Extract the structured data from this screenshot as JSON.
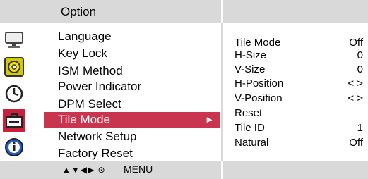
{
  "header": {
    "title": "Option"
  },
  "menu": {
    "items": [
      {
        "label": "Language"
      },
      {
        "label": "Key Lock"
      },
      {
        "label": "ISM Method"
      },
      {
        "label": "Power Indicator"
      },
      {
        "label": "DPM Select"
      },
      {
        "label": "Tile Mode",
        "selected": true
      },
      {
        "label": "Network Setup"
      },
      {
        "label": "Factory Reset"
      }
    ],
    "selected_arrow": "►"
  },
  "submenu": {
    "rows": [
      {
        "label": "Tile Mode",
        "value": "Off"
      },
      {
        "label": "H-Size",
        "value": "0"
      },
      {
        "label": "V-Size",
        "value": "0"
      },
      {
        "label": "H-Position",
        "value": "< >"
      },
      {
        "label": "V-Position",
        "value": "< >"
      },
      {
        "label": "Reset",
        "value": ""
      },
      {
        "label": "Tile ID",
        "value": "1"
      },
      {
        "label": "Natural",
        "value": "Off"
      }
    ]
  },
  "footer": {
    "nav_symbols": "▲▼◀▶ ⊙",
    "menu_label": "MENU"
  },
  "icons": {
    "left": [
      "monitor-icon",
      "color-disc-icon",
      "clock-icon",
      "toolbox-icon",
      "info-icon"
    ],
    "active_color": "#c8203d"
  }
}
